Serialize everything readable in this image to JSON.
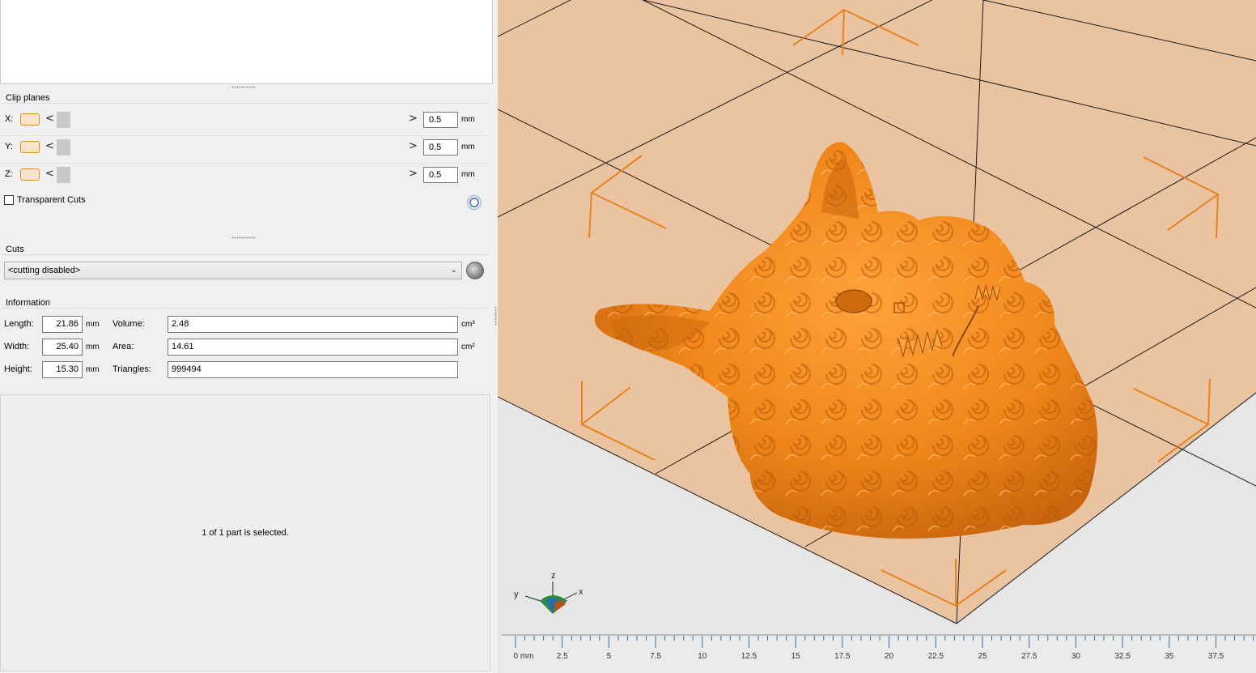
{
  "clip_planes": {
    "title": "Clip planes",
    "rows": [
      {
        "axis": "X:",
        "value": "0.5",
        "unit": "mm",
        "left_arrow": "<",
        "right_arrow": ">"
      },
      {
        "axis": "Y:",
        "value": "0.5",
        "unit": "mm",
        "left_arrow": "<",
        "right_arrow": ">"
      },
      {
        "axis": "Z:",
        "value": "0.5",
        "unit": "mm",
        "left_arrow": "<",
        "right_arrow": ">"
      }
    ],
    "transparent_cuts_label": "Transparent Cuts",
    "transparent_cuts_checked": false
  },
  "cuts": {
    "title": "Cuts",
    "selected": "<cutting disabled>"
  },
  "information": {
    "title": "Information",
    "length_label": "Length:",
    "length_value": "21.86",
    "width_label": "Width:",
    "width_value": "25.40",
    "height_label": "Height:",
    "height_value": "15.30",
    "dim_unit": "mm",
    "volume_label": "Volume:",
    "volume_value": "2.48",
    "volume_unit": "cm³",
    "area_label": "Area:",
    "area_value": "14.61",
    "area_unit": "cm²",
    "triangles_label": "Triangles:",
    "triangles_value": "999494"
  },
  "status_text": "1 of 1 part is selected.",
  "viewport": {
    "axes": {
      "x": "x",
      "y": "y",
      "z": "z"
    },
    "ruler_labels": [
      "0 mm",
      "2.5",
      "5",
      "7.5",
      "10",
      "12.5",
      "15",
      "17.5",
      "20",
      "22.5",
      "25",
      "27.5",
      "30",
      "32.5",
      "35",
      "37.5"
    ],
    "colors": {
      "model": "#f28a1c",
      "plate": "#eac3a0",
      "accent": "#e8821e"
    }
  }
}
